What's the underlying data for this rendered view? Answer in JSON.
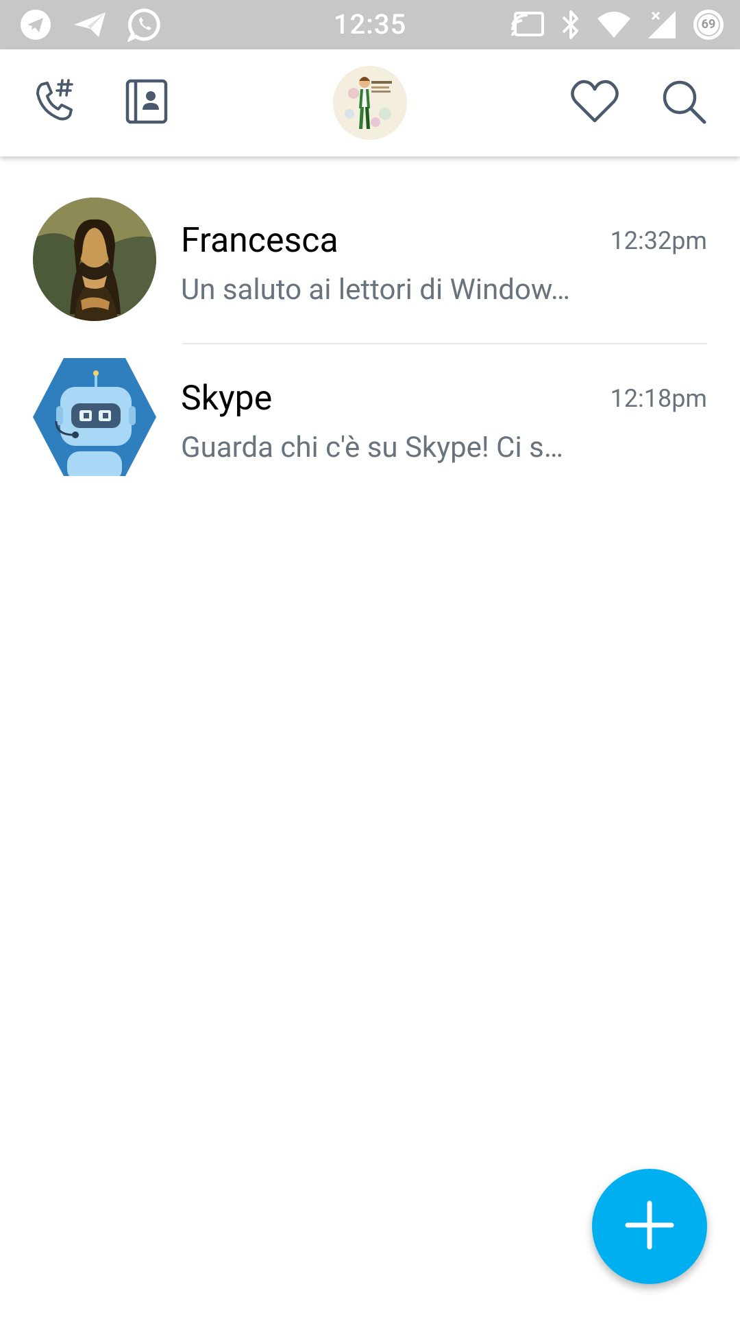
{
  "status_bar": {
    "time": "12:35",
    "battery_level": "69",
    "left_icons": [
      "telegram-icon",
      "send-icon",
      "whatsapp-icon"
    ],
    "right_icons": [
      "cast-icon",
      "bluetooth-icon",
      "wifi-icon",
      "cellular-signal-icon",
      "battery-icon"
    ]
  },
  "app_bar": {
    "left_icons": [
      "dialpad-icon",
      "contacts-icon"
    ],
    "center": "profile-avatar",
    "right_icons": [
      "heart-icon",
      "search-icon"
    ]
  },
  "conversations": [
    {
      "name": "Francesca",
      "time": "12:32pm",
      "preview": "Un saluto ai lettori di Window…",
      "avatar": "painting-portrait"
    },
    {
      "name": "Skype",
      "time": "12:18pm",
      "preview": "Guarda chi c'è su Skype! Ci s…",
      "avatar": "bot-hexagon"
    }
  ],
  "fab": {
    "icon": "plus-icon"
  },
  "colors": {
    "accent": "#00aff0",
    "status_bar": "#c7c7c7",
    "secondary_text": "#68737d",
    "icon": "#4a5a6c"
  }
}
